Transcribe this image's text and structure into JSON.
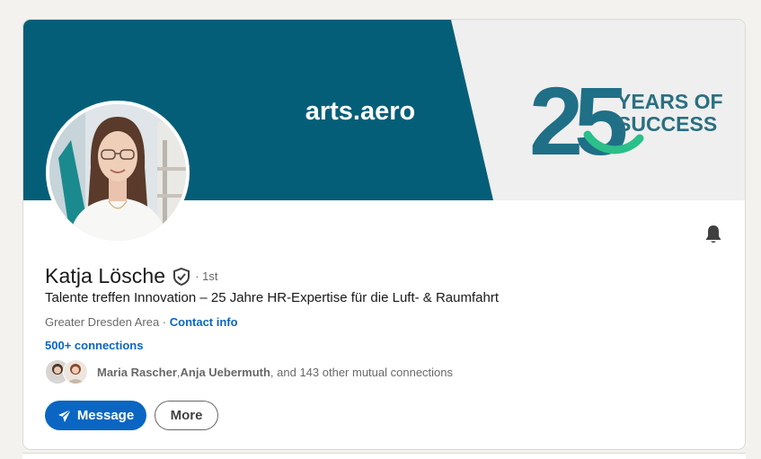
{
  "banner": {
    "brand": "arts.aero",
    "anniversary_number": "25",
    "anniversary_line1": "YEARS OF",
    "anniversary_line2": "SUCCESS",
    "colors": {
      "teal": "#055e78",
      "light": "#efefef",
      "green": "#2bbf8a"
    }
  },
  "profile": {
    "name": "Katja Lösche",
    "degree": "· 1st",
    "headline": "Talente treffen Innovation – 25 Jahre HR-Expertise für die Luft- & Raumfahrt",
    "location": "Greater Dresden Area",
    "separator": " · ",
    "contact_info": "Contact info",
    "connections": "500+ connections"
  },
  "mutual": {
    "person1": "Maria Rascher",
    "comma": ", ",
    "person2": "Anja Uebermuth",
    "rest": ", and 143 other mutual connections"
  },
  "actions": {
    "message_label": "Message",
    "more_label": "More"
  },
  "icons": {
    "verified": "shield-check-icon",
    "bell": "bell-icon",
    "message": "paper-plane-icon"
  },
  "colors": {
    "accent": "#0a66c2"
  }
}
